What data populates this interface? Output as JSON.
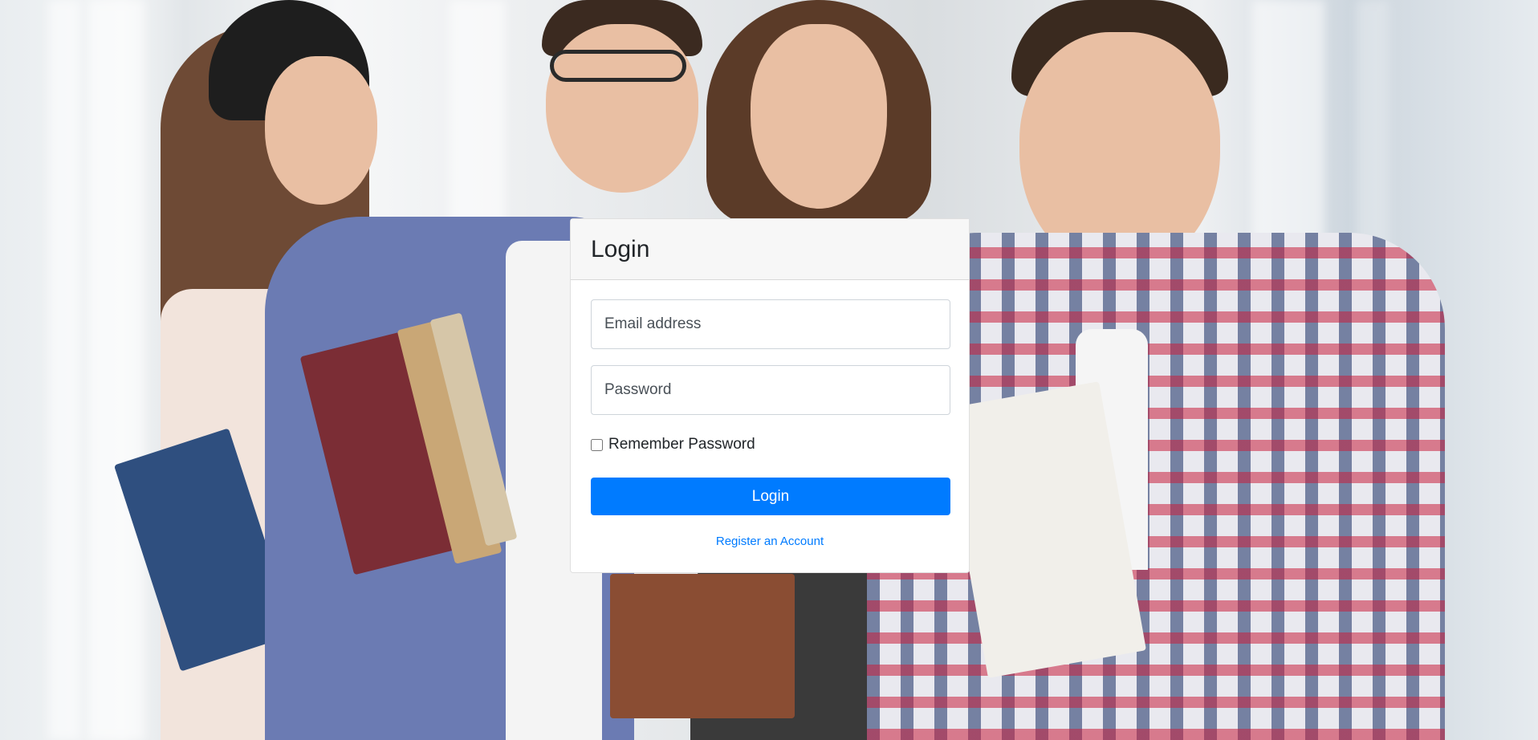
{
  "login_card": {
    "title": "Login",
    "email_placeholder": "Email address",
    "password_placeholder": "Password",
    "remember_label": "Remember Password",
    "submit_label": "Login",
    "register_link": "Register an Account"
  },
  "colors": {
    "primary": "#007bff",
    "card_header_bg": "#f7f7f7"
  }
}
